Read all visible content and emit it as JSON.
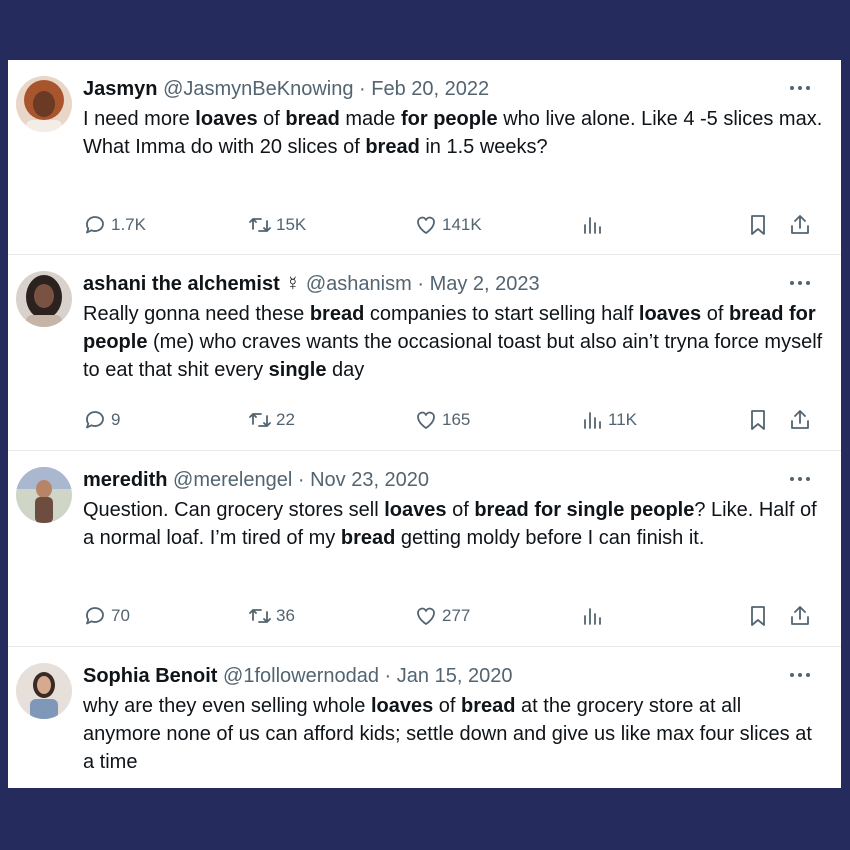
{
  "tweets": [
    {
      "name": "Jasmyn",
      "handle": "@JasmynBeKnowing",
      "separator": "·",
      "date": "Feb 20, 2022",
      "body": [
        [
          "I need more ",
          ""
        ],
        [
          "loaves",
          "b"
        ],
        [
          " of ",
          ""
        ],
        [
          "bread",
          "b"
        ],
        [
          " made ",
          ""
        ],
        [
          "for people",
          "b"
        ],
        [
          " who live alone. Like 4 -5 slices max.",
          ""
        ],
        [
          "\n",
          "br"
        ],
        [
          "What Imma do with 20 slices of ",
          ""
        ],
        [
          "bread",
          "b"
        ],
        [
          " in 1.5 weeks?",
          ""
        ]
      ],
      "replies": "1.7K",
      "retweets": "15K",
      "likes": "141K",
      "views": "",
      "avatar_color": "#b5623a"
    },
    {
      "name": "ashani the alchemist ☿",
      "handle": "@ashanism",
      "separator": "·",
      "date": "May 2, 2023",
      "body": [
        [
          "Really gonna need these ",
          ""
        ],
        [
          "bread",
          "b"
        ],
        [
          " companies to start selling half ",
          ""
        ],
        [
          "loaves",
          "b"
        ],
        [
          " of ",
          ""
        ],
        [
          "bread for people",
          "b"
        ],
        [
          " (me) who craves wants the occasional toast but also ain’t tryna force myself to eat that shit every ",
          ""
        ],
        [
          "single",
          "b"
        ],
        [
          " day",
          ""
        ]
      ],
      "replies": "9",
      "retweets": "22",
      "likes": "165",
      "views": "11K",
      "avatar_color": "#4a3f3a"
    },
    {
      "name": "meredith",
      "handle": "@merelengel",
      "separator": "·",
      "date": "Nov 23, 2020",
      "body": [
        [
          "Question. Can grocery stores sell ",
          ""
        ],
        [
          "loaves",
          "b"
        ],
        [
          " of ",
          ""
        ],
        [
          "bread for single people",
          "b"
        ],
        [
          "? Like. Half of a normal loaf. I’m tired of my ",
          ""
        ],
        [
          "bread",
          "b"
        ],
        [
          " getting moldy before I can finish it.",
          ""
        ]
      ],
      "replies": "70",
      "retweets": "36",
      "likes": "277",
      "views": "",
      "avatar_color": "#8a9a84"
    },
    {
      "name": "Sophia Benoit",
      "handle": "@1followernodad",
      "separator": "·",
      "date": "Jan 15, 2020",
      "body": [
        [
          "why are they even selling whole ",
          ""
        ],
        [
          "loaves",
          "b"
        ],
        [
          " of ",
          ""
        ],
        [
          "bread",
          "b"
        ],
        [
          " at the grocery store at all anymore none of us can afford kids; settle down and give us like max four slices at a time",
          ""
        ]
      ],
      "replies": "",
      "retweets": "",
      "likes": "",
      "views": "",
      "avatar_color": "#c9b8ad"
    }
  ],
  "icons": {
    "reply": "reply-icon",
    "retweet": "retweet-icon",
    "like": "heart-icon",
    "views": "views-icon",
    "bookmark": "bookmark-icon",
    "share": "share-icon",
    "more": "more-icon"
  }
}
